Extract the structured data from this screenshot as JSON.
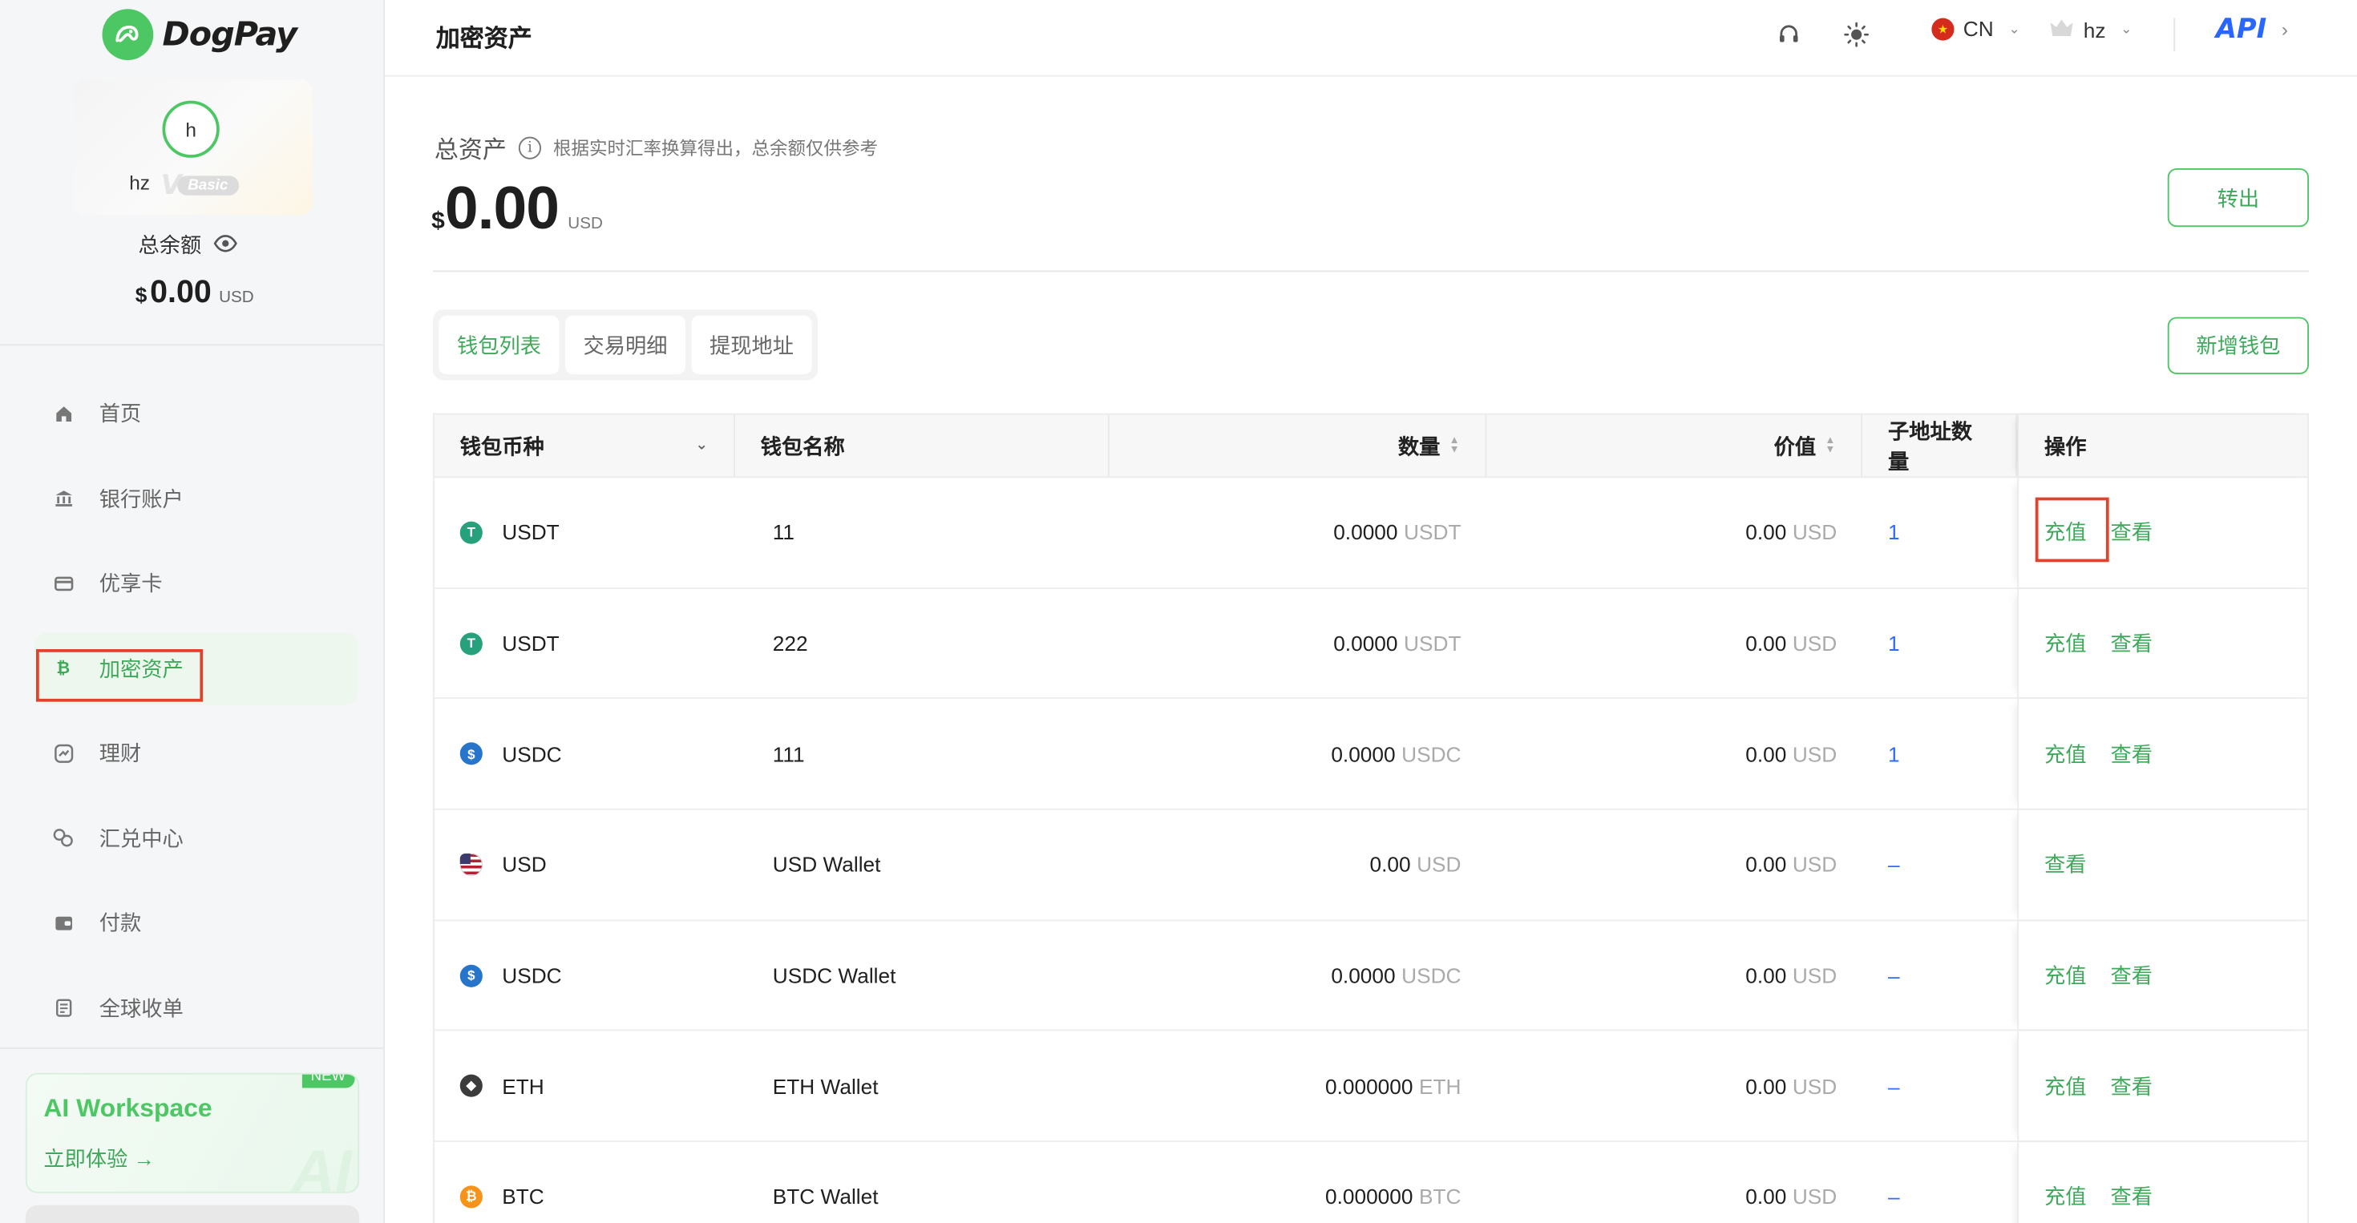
{
  "app": {
    "name": "DogPay"
  },
  "sidebar": {
    "profile": {
      "avatar_initial": "h",
      "username": "hz",
      "vip_level": "Basic"
    },
    "balance_label": "总余额",
    "balance_currency_symbol": "$",
    "balance_amount": "0.00",
    "balance_unit": "USD",
    "nav": [
      {
        "label": "首页",
        "icon": "home-icon"
      },
      {
        "label": "银行账户",
        "icon": "bank-icon"
      },
      {
        "label": "优享卡",
        "icon": "card-icon"
      },
      {
        "label": "加密资产",
        "icon": "bitcoin-icon",
        "active": true
      },
      {
        "label": "理财",
        "icon": "finance-icon"
      },
      {
        "label": "汇兑中心",
        "icon": "exchange-icon"
      },
      {
        "label": "付款",
        "icon": "wallet-icon"
      },
      {
        "label": "全球收单",
        "icon": "receipt-icon"
      }
    ],
    "promo": {
      "title": "AI Workspace",
      "cta": "立即体验 →",
      "badge": "NEW"
    }
  },
  "topbar": {
    "title": "加密资产",
    "language": "CN",
    "user": "hz",
    "api_label": "API"
  },
  "summary": {
    "title": "总资产",
    "note": "根据实时汇率换算得出，总余额仅供参考",
    "currency_symbol": "$",
    "amount": "0.00",
    "unit": "USD",
    "transfer_button": "转出"
  },
  "tabs": [
    {
      "label": "钱包列表",
      "active": true
    },
    {
      "label": "交易明细",
      "active": false
    },
    {
      "label": "提现地址",
      "active": false
    }
  ],
  "new_wallet_button": "新增钱包",
  "table": {
    "columns": [
      "钱包币种",
      "钱包名称",
      "数量",
      "价值",
      "子地址数量",
      "操作"
    ],
    "rows": [
      {
        "coin": "USDT",
        "icon": "tether-icon",
        "icon_color": "#26a17b",
        "name": "11",
        "qty": "0.0000",
        "qty_unit": "USDT",
        "value": "0.00",
        "value_unit": "USD",
        "sub": "1",
        "actions": [
          "充值",
          "查看"
        ]
      },
      {
        "coin": "USDT",
        "icon": "tether-icon",
        "icon_color": "#26a17b",
        "name": "222",
        "qty": "0.0000",
        "qty_unit": "USDT",
        "value": "0.00",
        "value_unit": "USD",
        "sub": "1",
        "actions": [
          "充值",
          "查看"
        ]
      },
      {
        "coin": "USDC",
        "icon": "usdc-icon",
        "icon_color": "#2775ca",
        "name": "111",
        "qty": "0.0000",
        "qty_unit": "USDC",
        "value": "0.00",
        "value_unit": "USD",
        "sub": "1",
        "actions": [
          "充值",
          "查看"
        ]
      },
      {
        "coin": "USD",
        "icon": "us-flag-icon",
        "icon_color": "#b22234",
        "name": "USD Wallet",
        "qty": "0.00",
        "qty_unit": "USD",
        "value": "0.00",
        "value_unit": "USD",
        "sub": "–",
        "actions": [
          "查看"
        ]
      },
      {
        "coin": "USDC",
        "icon": "usdc-icon",
        "icon_color": "#2775ca",
        "name": "USDC Wallet",
        "qty": "0.0000",
        "qty_unit": "USDC",
        "value": "0.00",
        "value_unit": "USD",
        "sub": "–",
        "actions": [
          "充值",
          "查看"
        ]
      },
      {
        "coin": "ETH",
        "icon": "ethereum-icon",
        "icon_color": "#3c3c3d",
        "name": "ETH Wallet",
        "qty": "0.000000",
        "qty_unit": "ETH",
        "value": "0.00",
        "value_unit": "USD",
        "sub": "–",
        "actions": [
          "充值",
          "查看"
        ]
      },
      {
        "coin": "BTC",
        "icon": "bitcoin-icon",
        "icon_color": "#f7931a",
        "name": "BTC Wallet",
        "qty": "0.000000",
        "qty_unit": "BTC",
        "value": "0.00",
        "value_unit": "USD",
        "sub": "–",
        "actions": [
          "充值",
          "查看"
        ]
      }
    ]
  }
}
